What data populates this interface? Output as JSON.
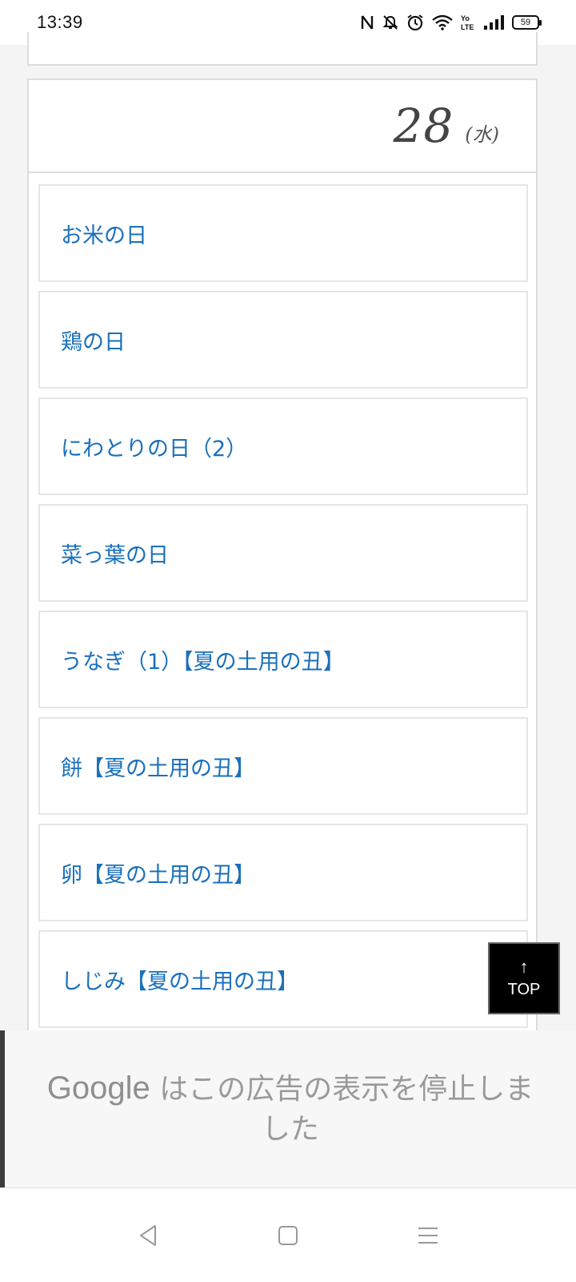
{
  "status_bar": {
    "time": "13:39",
    "battery": "59",
    "icons": [
      "nfc-icon",
      "bell-off-icon",
      "alarm-icon",
      "wifi-icon",
      "volte-icon",
      "signal-icon",
      "battery-icon"
    ]
  },
  "day": {
    "number": "28",
    "weekday": "(水)"
  },
  "events": [
    {
      "label": "お米の日"
    },
    {
      "label": "鶏の日"
    },
    {
      "label": "にわとりの日（2）"
    },
    {
      "label": "菜っ葉の日"
    },
    {
      "label": "うなぎ（1）【夏の土用の丑】"
    },
    {
      "label": "餅【夏の土用の丑】"
    },
    {
      "label": "卵【夏の土用の丑】"
    },
    {
      "label": "しじみ【夏の土用の丑】"
    }
  ],
  "top_button": {
    "arrow": "↑",
    "label": "TOP"
  },
  "ad": {
    "brand": "Google",
    "message": " はこの広告の表示を停止しました"
  },
  "nav_bar": {
    "icons": [
      "back-icon",
      "home-icon",
      "menu-icon"
    ]
  },
  "colors": {
    "link": "#1b70bb",
    "border": "#dcdcdc",
    "background": "#f4f4f4"
  }
}
